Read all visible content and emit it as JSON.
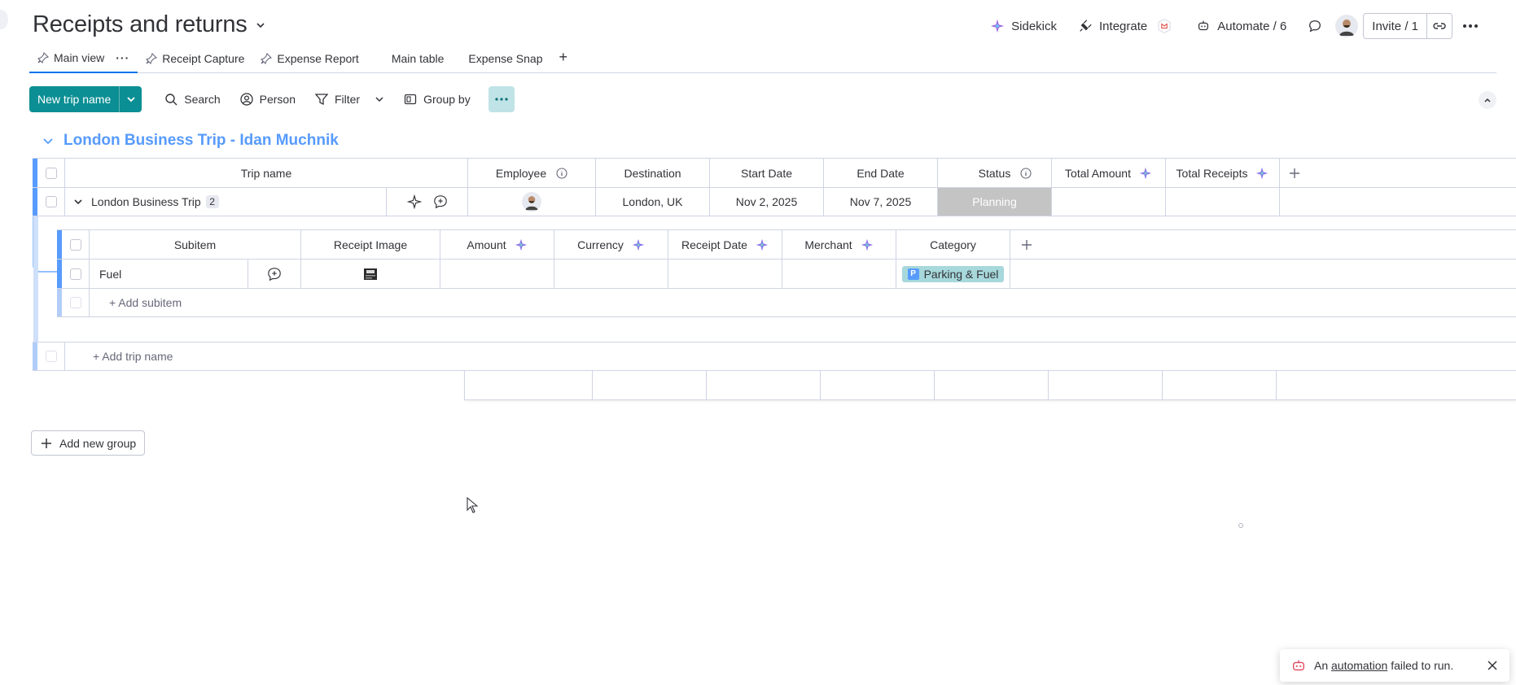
{
  "board": {
    "title": "Receipts and returns"
  },
  "header": {
    "sidekick": "Sidekick",
    "integrate": "Integrate",
    "automate": "Automate / 6",
    "invite": "Invite / 1"
  },
  "tabs": [
    {
      "label": "Main view",
      "pinned": true,
      "active": true
    },
    {
      "label": "Receipt Capture",
      "pinned": true
    },
    {
      "label": "Expense Report",
      "pinned": true
    },
    {
      "label": "Main table",
      "pinned": false
    },
    {
      "label": "Expense Snap",
      "pinned": false
    }
  ],
  "toolbar": {
    "new_item": "New trip name",
    "search": "Search",
    "person": "Person",
    "filter": "Filter",
    "group_by": "Group by"
  },
  "group": {
    "title": "London Business Trip - Idan Muchnik",
    "columns": {
      "trip_name": "Trip name",
      "employee": "Employee",
      "destination": "Destination",
      "start_date": "Start Date",
      "end_date": "End Date",
      "status": "Status",
      "total_amount": "Total Amount",
      "total_receipts": "Total Receipts"
    },
    "item": {
      "name": "London Business Trip",
      "subitem_count": "2",
      "destination": "London, UK",
      "start_date": "Nov 2, 2025",
      "end_date": "Nov 7, 2025",
      "status": "Planning"
    },
    "sub_columns": {
      "subitem": "Subitem",
      "receipt_image": "Receipt Image",
      "amount": "Amount",
      "currency": "Currency",
      "receipt_date": "Receipt Date",
      "merchant": "Merchant",
      "category": "Category"
    },
    "subitem": {
      "name": "Fuel",
      "category": "Parking & Fuel",
      "category_icon": "P"
    },
    "add_subitem": "+ Add subitem",
    "add_item": "+ Add trip name"
  },
  "add_group": "Add new group",
  "toast": {
    "prefix": "An",
    "link": "automation",
    "suffix": "failed to run."
  },
  "colors": {
    "accent": "#0b8f94",
    "group": "#579bfc",
    "status_planning": "#c4c4c4",
    "category_chip": "#a7d8db"
  }
}
